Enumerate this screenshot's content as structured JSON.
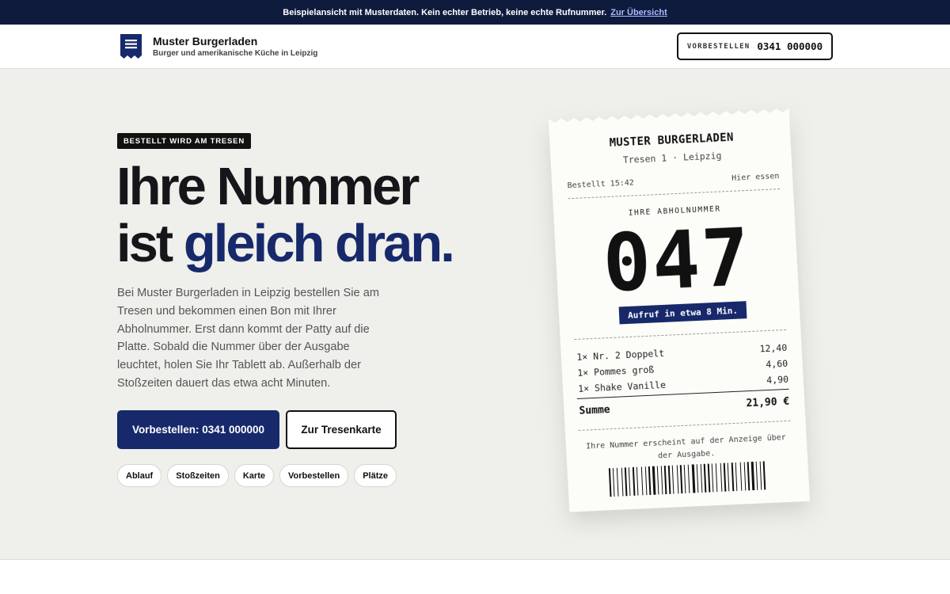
{
  "notice": {
    "text": "Beispielansicht mit Musterdaten. Kein echter Betrieb, keine echte Rufnummer.",
    "link": "Zur Übersicht"
  },
  "header": {
    "brand_name": "Muster Burgerladen",
    "brand_sub": "Burger und amerikanische Küche in Leipzig",
    "order_label": "VORBESTELLEN",
    "order_number": "0341 000000"
  },
  "hero": {
    "tag": "BESTELLT WIRD AM TRESEN",
    "headline_line1": "Ihre Nummer",
    "headline_line2_plain": "ist",
    "headline_line2_accent": "gleich dran.",
    "lead": "Bei Muster Burgerladen in Leipzig bestellen Sie am Tresen und bekommen einen Bon mit Ihrer Abholnummer. Erst dann kommt der Patty auf die Platte. Sobald die Nummer über der Ausgabe leuchtet, holen Sie Ihr Tablett ab. Außerhalb der Stoßzeiten dauert das etwa acht Minuten.",
    "primary_button": "Vorbestellen: 0341 000000",
    "secondary_button": "Zur Tresenkarte",
    "chips": [
      "Ablauf",
      "Stoßzeiten",
      "Karte",
      "Vorbestellen",
      "Plätze"
    ]
  },
  "receipt": {
    "title": "MUSTER BURGERLADEN",
    "subtitle": "Tresen 1 · Leipzig",
    "ordered": "Bestellt 15:42",
    "mode": "Hier essen",
    "number_label": "IHRE ABHOLNUMMER",
    "number": "047",
    "eta": "Aufruf in etwa 8 Min.",
    "items": [
      {
        "name": "1× Nr. 2 Doppelt",
        "price": "12,40"
      },
      {
        "name": "1× Pommes groß",
        "price": "4,60"
      },
      {
        "name": "1× Shake Vanille",
        "price": "4,90"
      }
    ],
    "total_label": "Summe",
    "total_value": "21,90 €",
    "note": "Ihre Nummer erscheint auf der Anzeige über der Ausgabe."
  },
  "colors": {
    "navy": "#17296b",
    "topbar": "#0f1b3d",
    "hero_bg": "#efefeb",
    "link": "#aab8ff"
  },
  "icons": {
    "logo": "receipt-logo-icon"
  }
}
